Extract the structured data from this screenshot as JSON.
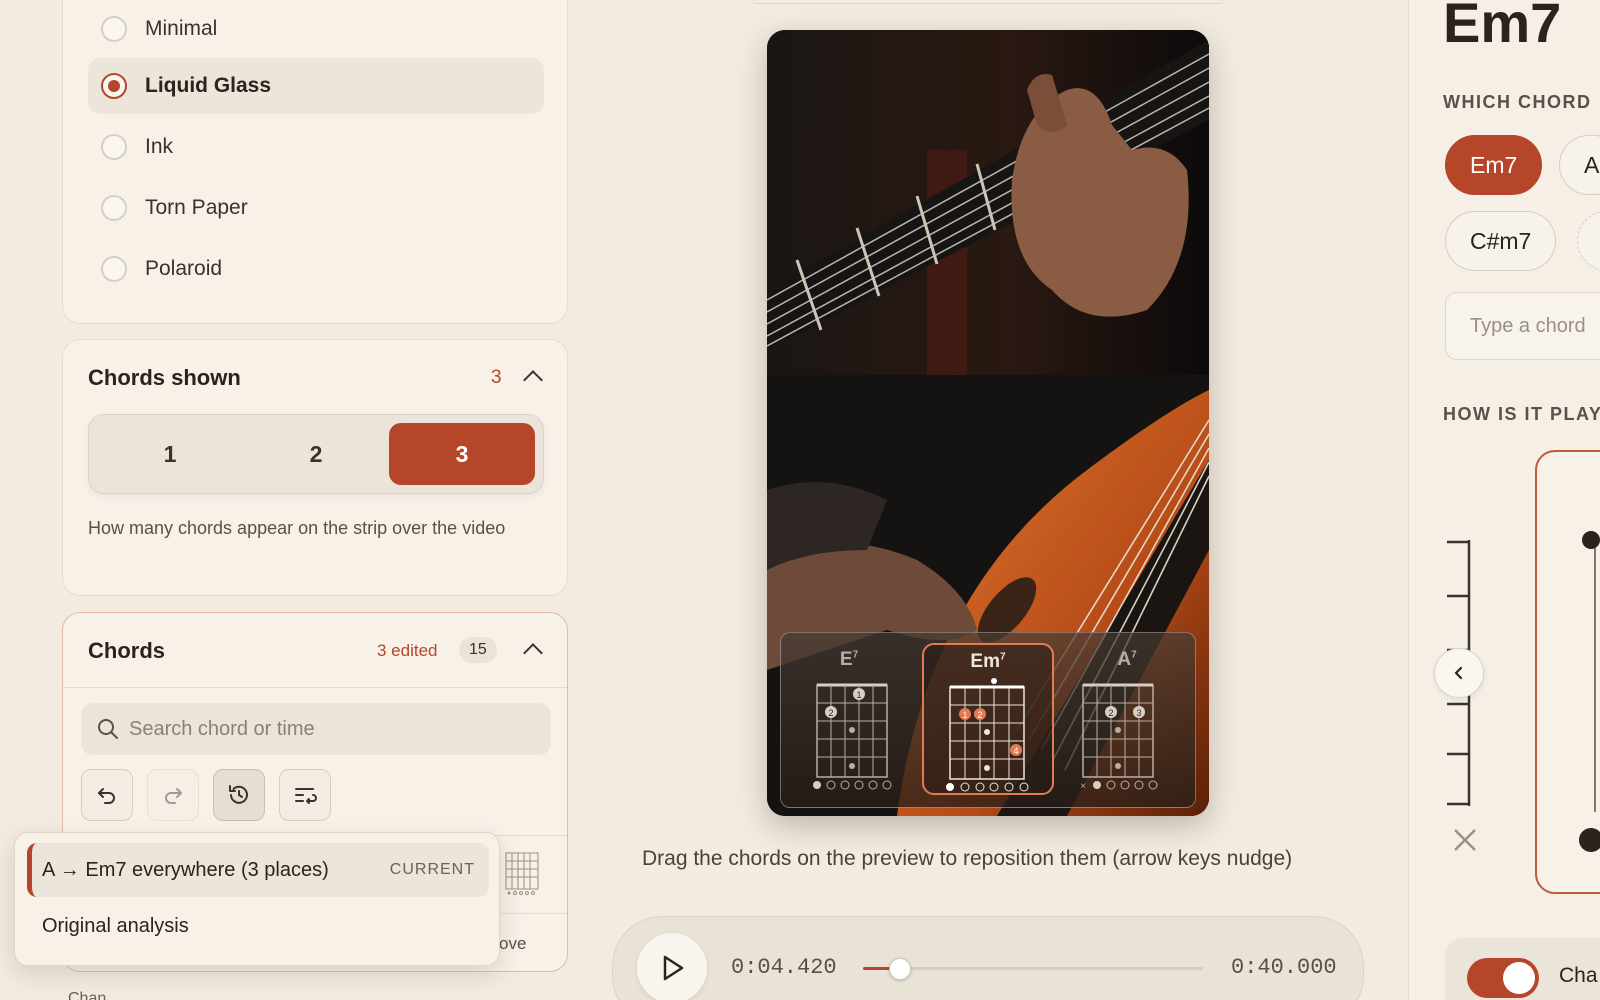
{
  "style_options": [
    {
      "label": "Minimal",
      "selected": false
    },
    {
      "label": "Liquid Glass",
      "selected": true
    },
    {
      "label": "Ink",
      "selected": false
    },
    {
      "label": "Torn Paper",
      "selected": false
    },
    {
      "label": "Polaroid",
      "selected": false
    }
  ],
  "chords_shown": {
    "title": "Chords shown",
    "count": "3",
    "options": [
      "1",
      "2",
      "3"
    ],
    "selected": "3",
    "help": "How many chords appear on the strip over the video"
  },
  "chords": {
    "title": "Chords",
    "edited": "3 edited",
    "total": "15",
    "search_placeholder": "Search chord or time",
    "move_label": "ove",
    "footer_text": "Chan"
  },
  "history_popup": {
    "current_label": "A → Em7 everywhere (3 places)",
    "current_tag": "CURRENT",
    "original_label": "Original analysis"
  },
  "preview": {
    "strip": [
      {
        "name": "E",
        "sup": "7",
        "active": false
      },
      {
        "name": "Em",
        "sup": "7",
        "active": true
      },
      {
        "name": "A",
        "sup": "7",
        "active": false
      }
    ],
    "drag_hint": "Drag the chords on the preview to reposition them (arrow keys nudge)"
  },
  "player": {
    "current_time": "0:04.420",
    "total_time": "0:40.000",
    "progress": 0.11
  },
  "inspector": {
    "chord": "Em7",
    "which_label": "WHICH CHORD",
    "options": [
      "Em7",
      "A",
      "C#m7"
    ],
    "input_placeholder": "Type a chord",
    "how_label": "HOW IS IT PLAY",
    "toggle_label": "Cha"
  },
  "colors": {
    "accent": "#b5462a",
    "background": "#f2ebe0"
  }
}
